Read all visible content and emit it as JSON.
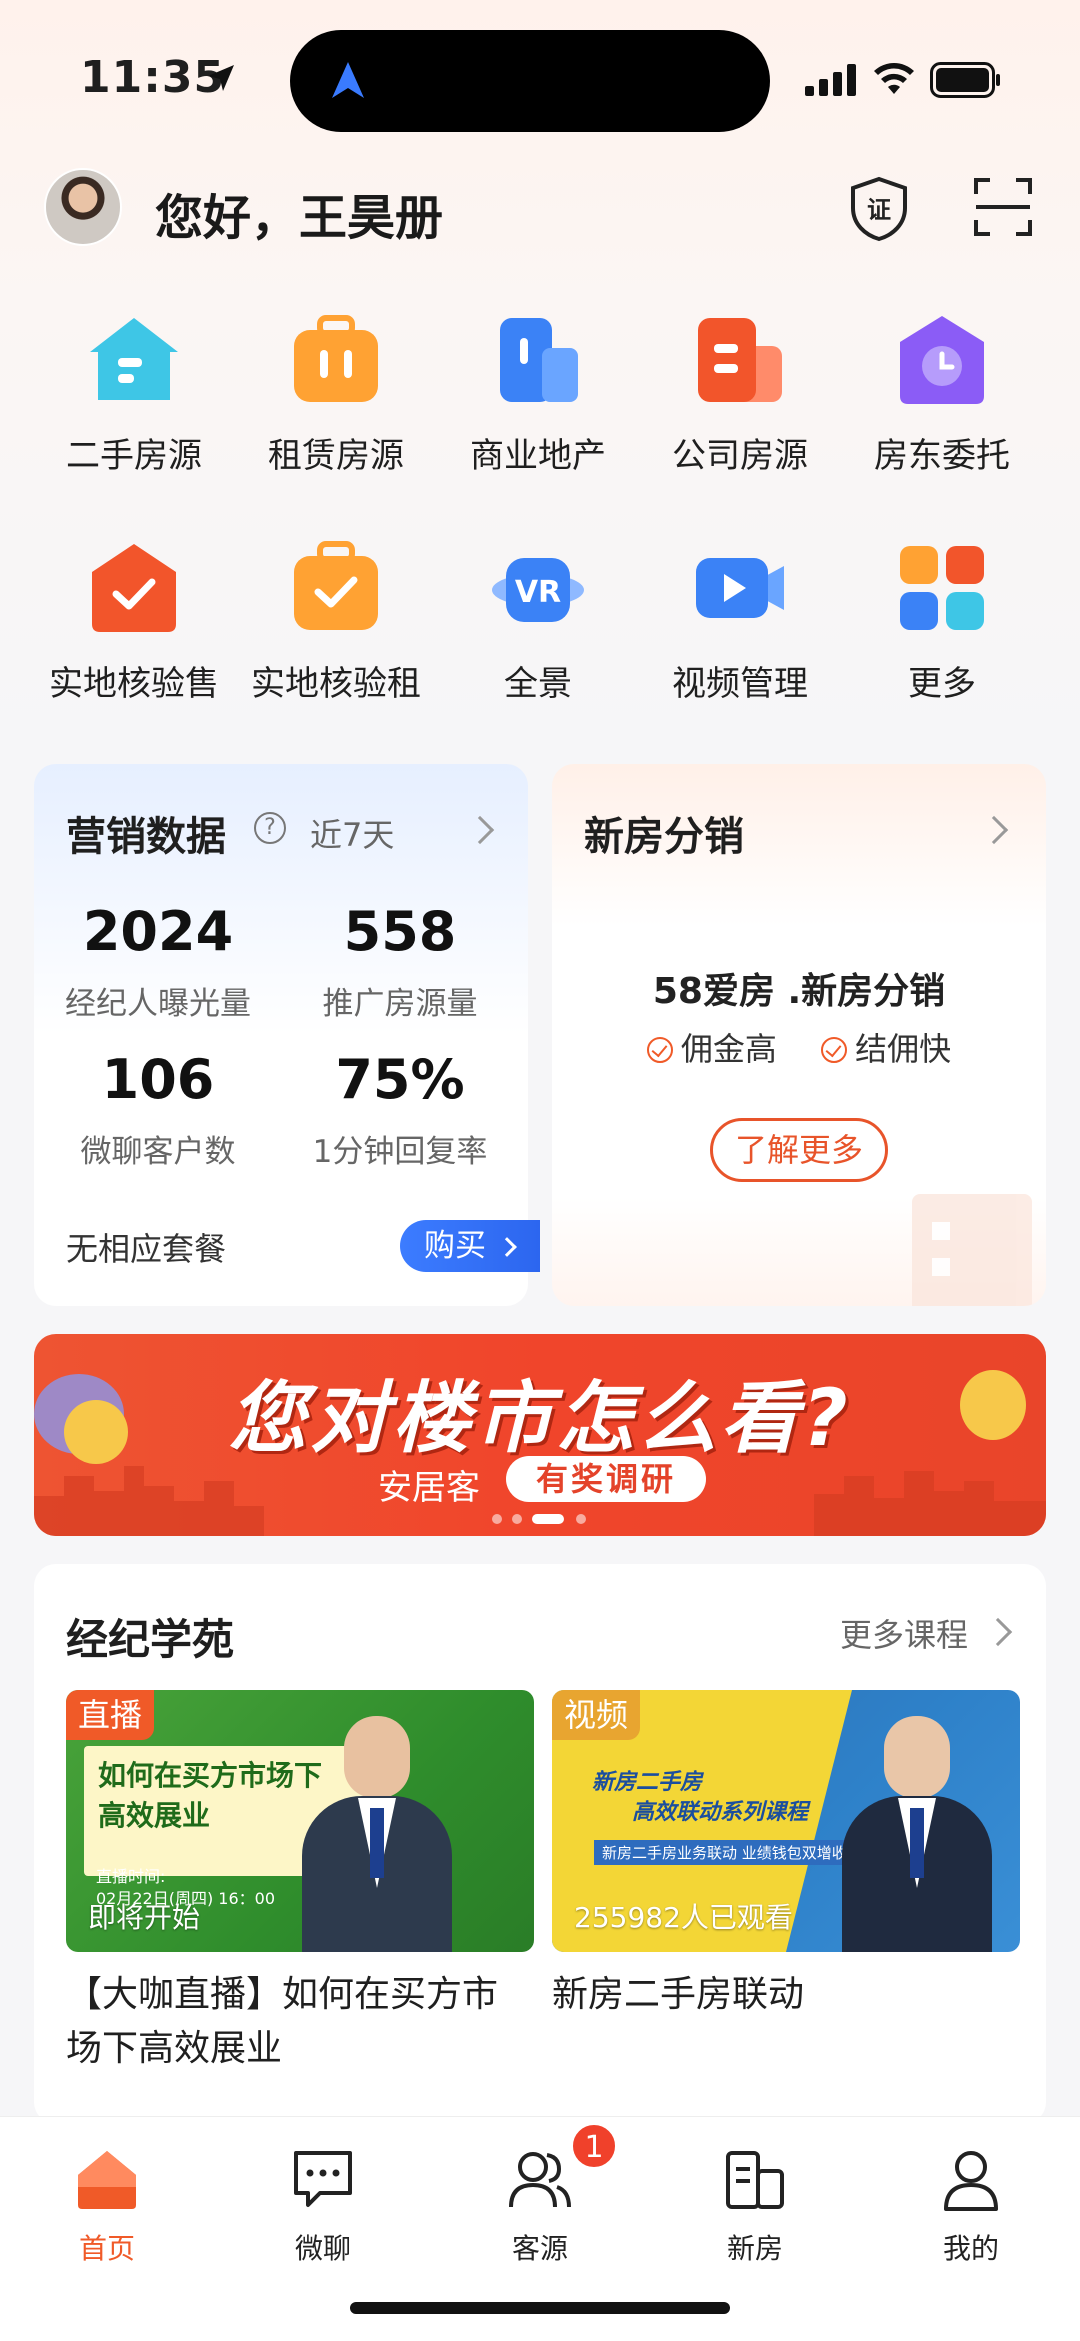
{
  "status_bar": {
    "time": "11:35"
  },
  "header": {
    "greeting": "您好，王昊册",
    "cert_label": "证"
  },
  "grid": [
    {
      "label": "二手房源",
      "icon": "house-icon",
      "color": "#3ec6e6"
    },
    {
      "label": "租赁房源",
      "icon": "suitcase-icon",
      "color": "#ffa233"
    },
    {
      "label": "商业地产",
      "icon": "building-icon",
      "color": "#3b82f6"
    },
    {
      "label": "公司房源",
      "icon": "office-icon",
      "color": "#f2552b"
    },
    {
      "label": "房东委托",
      "icon": "clock-house-icon",
      "color": "#8b5cf6"
    },
    {
      "label": "实地核验售",
      "icon": "check-house-icon",
      "color": "#f2552b"
    },
    {
      "label": "实地核验租",
      "icon": "check-suitcase-icon",
      "color": "#ffa233"
    },
    {
      "label": "全景",
      "icon": "vr-icon",
      "color": "#3b82f6",
      "icon_text": "VR"
    },
    {
      "label": "视频管理",
      "icon": "video-icon",
      "color": "#3b82f6"
    },
    {
      "label": "更多",
      "icon": "more-grid-icon",
      "color": "#ff8a2a"
    }
  ],
  "marketing": {
    "title": "营销数据",
    "help": "?",
    "period": "近7天",
    "stats": [
      {
        "value": "2024",
        "label": "经纪人曝光量"
      },
      {
        "value": "558",
        "label": "推广房源量"
      },
      {
        "value": "106",
        "label": "微聊客户数"
      },
      {
        "value": "75%",
        "label": "1分钟回复率"
      }
    ],
    "no_package": "无相应套餐",
    "buy": "购买"
  },
  "new_house": {
    "title": "新房分销",
    "brand": "58爱房 .新房分销",
    "tag1": "佣金高",
    "tag2": "结佣快",
    "learn_more": "了解更多"
  },
  "banner": {
    "title": "您对楼市怎么看?",
    "sub": "安居客",
    "tag": "有奖调研"
  },
  "academy": {
    "title": "经纪学苑",
    "more": "更多课程",
    "courses": [
      {
        "badge": "直播",
        "board_line1": "如何在买方市场下",
        "board_line2": "高效展业",
        "time_label": "直播时间:",
        "time_value": "02月22日(周四) 16：00",
        "bottom": "即将开始",
        "caption_line1": "【大咖直播】如何在买方市",
        "caption_line2": "场下高效展业"
      },
      {
        "badge": "视频",
        "title_line1": "新房二手房",
        "title_line2": "高效联动系列课程",
        "sub": "新房二手房业务联动 业绩钱包双增收",
        "bottom": "255982人已观看",
        "caption_line1": "新房二手房联动"
      }
    ]
  },
  "tabbar": {
    "tabs": [
      {
        "label": "首页",
        "icon": "home-icon"
      },
      {
        "label": "微聊",
        "icon": "chat-icon"
      },
      {
        "label": "客源",
        "icon": "clients-icon"
      },
      {
        "label": "新房",
        "icon": "new-house-icon"
      },
      {
        "label": "我的",
        "icon": "profile-icon"
      }
    ],
    "badge": "1",
    "accent": "#f05a28"
  }
}
